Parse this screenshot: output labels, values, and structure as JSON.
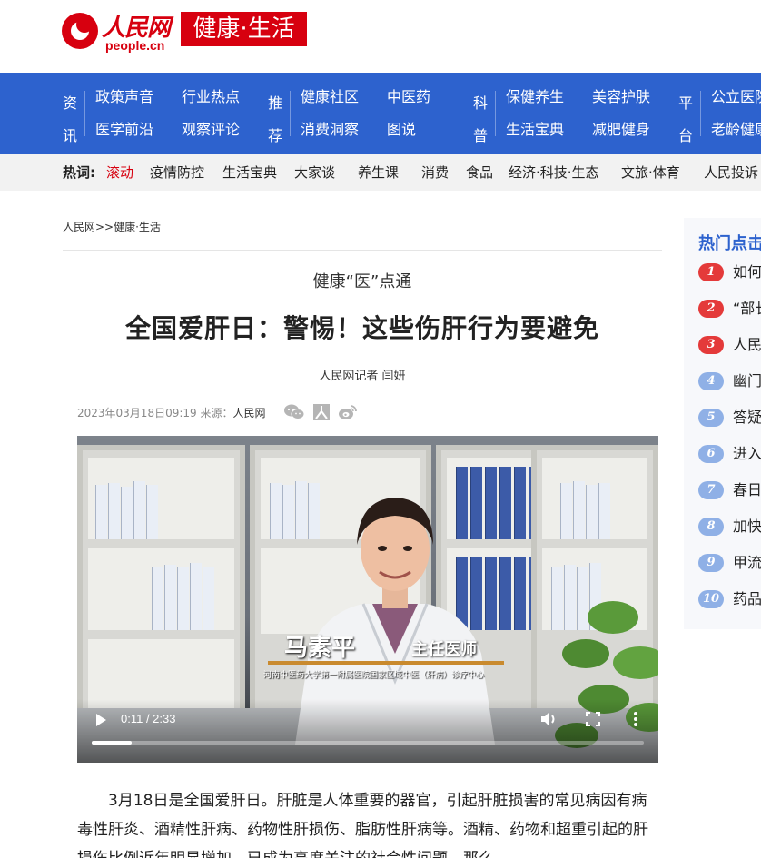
{
  "header": {
    "logo_text": "人民网",
    "logo_domain": "people.cn",
    "channel_name": "健康·生活"
  },
  "nav": {
    "groups": [
      {
        "category": "资讯",
        "items": [
          "政策声音",
          "行业热点",
          "医学前沿",
          "观察评论"
        ]
      },
      {
        "category": "推荐",
        "items": [
          "健康社区",
          "中医药",
          "消费洞察",
          "图说"
        ]
      },
      {
        "category": "科普",
        "items": [
          "保健养生",
          "美容护肤",
          "生活宝典",
          "减肥健身"
        ]
      },
      {
        "category": "平台",
        "items": [
          "公立医院",
          "老龄健康"
        ]
      }
    ]
  },
  "hot_words": {
    "label": "热词:",
    "items": [
      "滚动",
      "疫情防控",
      "生活宝典",
      "大家谈",
      "养生课",
      "消费",
      "食品",
      "经济·科技·生态",
      "文旅·体育",
      "人民投诉"
    ]
  },
  "breadcrumb": "人民网>>健康·生活",
  "article": {
    "column": "健康“医”点通",
    "title": "全国爱肝日：警惕！这些伤肝行为要避免",
    "author": "人民网记者 闫妍",
    "date": "2023年03月18日09:19",
    "source_label": "来源：",
    "source": "人民网",
    "paragraph": "3月18日是全国爱肝日。肝脏是人体重要的器官，引起肝脏损害的常见病因有病毒性肝炎、酒精性肝病、药物性肝损伤、脂肪性肝病等。酒精、药物和超重引起的肝损伤比例近年明显增加，已成为高度关注的社会性问题。那么"
  },
  "video": {
    "person_name": "马素平",
    "person_role": "主任医师",
    "person_org": "河南中医药大学第一附属医院国家区域中医（肝病）诊疗中心",
    "time_display": "0:11 / 2:33",
    "progress": 0.072
  },
  "sidebar": {
    "title": "热门点击",
    "items": [
      {
        "rank": "1",
        "text": "如何"
      },
      {
        "rank": "2",
        "text": "“部长"
      },
      {
        "rank": "3",
        "text": "人民"
      },
      {
        "rank": "4",
        "text": "幽门"
      },
      {
        "rank": "5",
        "text": "答疑"
      },
      {
        "rank": "6",
        "text": "进入"
      },
      {
        "rank": "7",
        "text": "春日"
      },
      {
        "rank": "8",
        "text": "加快"
      },
      {
        "rank": "9",
        "text": "甲流"
      },
      {
        "rank": "10",
        "text": "药品"
      }
    ]
  }
}
